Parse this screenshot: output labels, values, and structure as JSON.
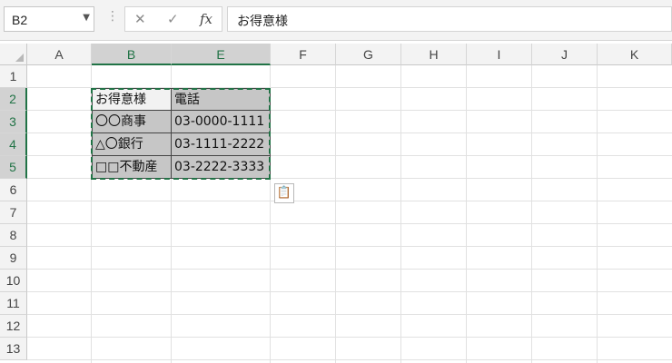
{
  "formula_bar": {
    "name_box": "B2",
    "cancel_icon": "✕",
    "enter_icon": "✓",
    "fx_label": "fx",
    "formula": "お得意様"
  },
  "columns": [
    "A",
    "B",
    "E",
    "F",
    "G",
    "H",
    "I",
    "J",
    "K"
  ],
  "rows": [
    "1",
    "2",
    "3",
    "4",
    "5",
    "6",
    "7",
    "8",
    "9",
    "10",
    "11",
    "12",
    "13"
  ],
  "selection": {
    "columns": [
      "B",
      "E"
    ],
    "rows": [
      "2",
      "3",
      "4",
      "5"
    ]
  },
  "table": {
    "header": [
      "お得意様",
      "電話"
    ],
    "rows": [
      [
        "〇〇商事",
        "03-0000-1111"
      ],
      [
        "△〇銀行",
        "03-1111-2222"
      ],
      [
        "□□不動産",
        "03-2222-3333"
      ]
    ]
  },
  "paste_options": {
    "icon": "paste-options-icon",
    "glyph": "📋"
  },
  "colors": {
    "accent": "#217346",
    "selected_header": "#d2d2d2",
    "cell_fill": "#c6c6c6"
  }
}
